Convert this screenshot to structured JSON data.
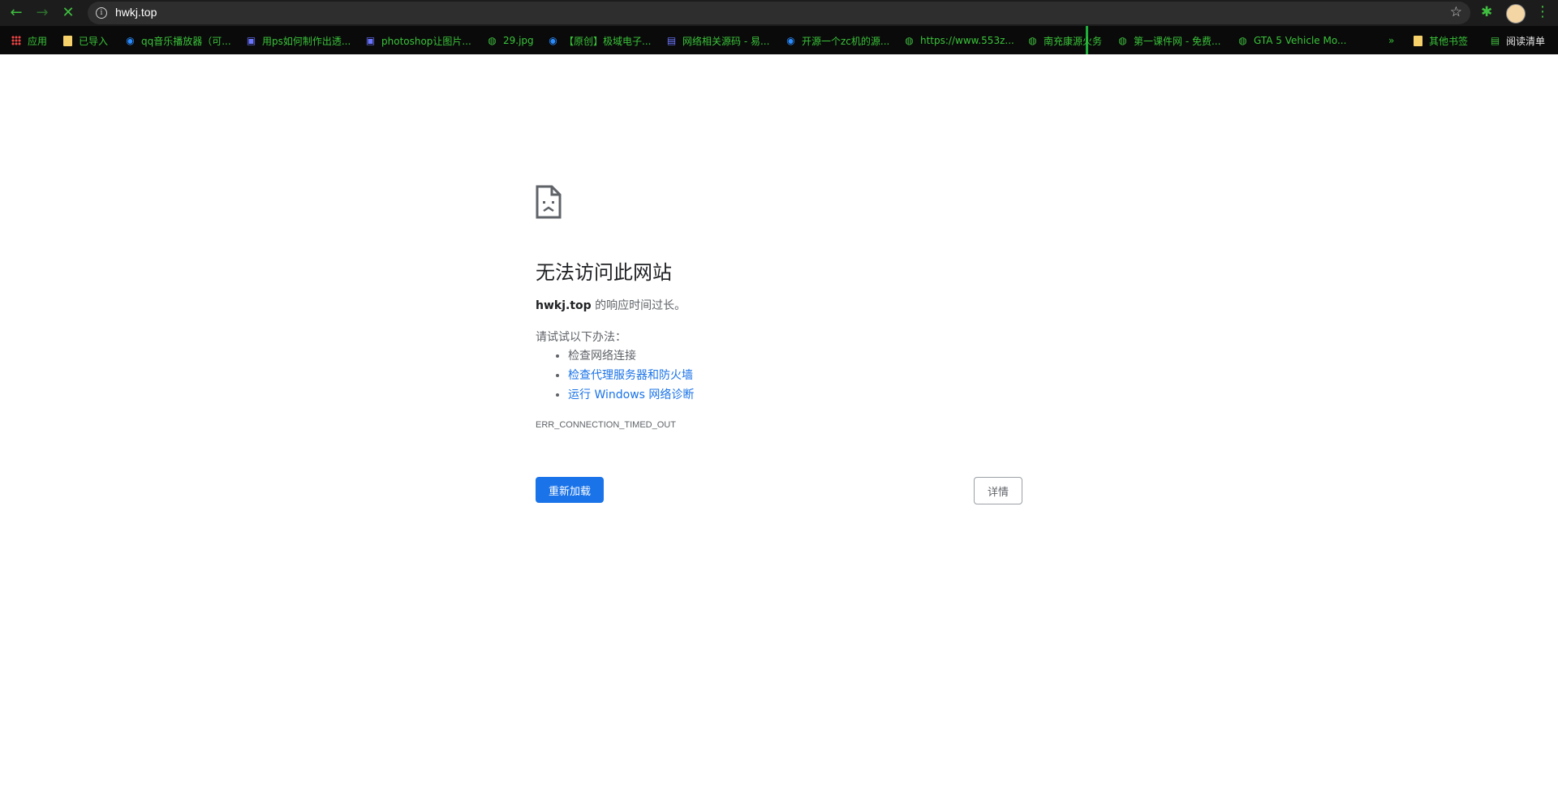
{
  "browser": {
    "url": "hwkj.top",
    "bookmarks": [
      {
        "label": "应用",
        "icon": "apps-grid-icon"
      },
      {
        "label": "已导入",
        "icon": "folder-icon"
      },
      {
        "label": "qq音乐播放器（可...",
        "icon": "eye-icon"
      },
      {
        "label": "用ps如何制作出透...",
        "icon": "baidu-paw-icon"
      },
      {
        "label": "photoshop让图片...",
        "icon": "baidu-paw-icon"
      },
      {
        "label": "29.jpg",
        "icon": "globe-icon"
      },
      {
        "label": "【原创】极域电子...",
        "icon": "eye-icon"
      },
      {
        "label": "网络相关源码 - 易...",
        "icon": "page-icon"
      },
      {
        "label": "开源一个zc机的源...",
        "icon": "eye-icon"
      },
      {
        "label": "https://www.553z...",
        "icon": "globe-icon"
      },
      {
        "label": "南充康源火务",
        "icon": "globe-icon"
      },
      {
        "label": "第一课件网 - 免费...",
        "icon": "globe-icon"
      },
      {
        "label": "GTA 5 Vehicle Mo...",
        "icon": "gta-icon"
      }
    ],
    "overflow_label": "»",
    "other_bookmarks": "其他书签",
    "reading_list": "阅读清单"
  },
  "error": {
    "title": "无法访问此网站",
    "host": "hwkj.top",
    "desc_suffix": " 的响应时间过长。",
    "try_label": "请试试以下办法：",
    "suggestions": [
      "检查网络连接",
      "检查代理服务器和防火墙",
      "运行 Windows 网络诊断"
    ],
    "code": "ERR_CONNECTION_TIMED_OUT",
    "reload_label": "重新加载",
    "details_label": "详情"
  },
  "colors": {
    "accent_green": "#3fbf3f",
    "primary_blue": "#1a73e8",
    "toolbar_bg": "#1c1c1c"
  }
}
